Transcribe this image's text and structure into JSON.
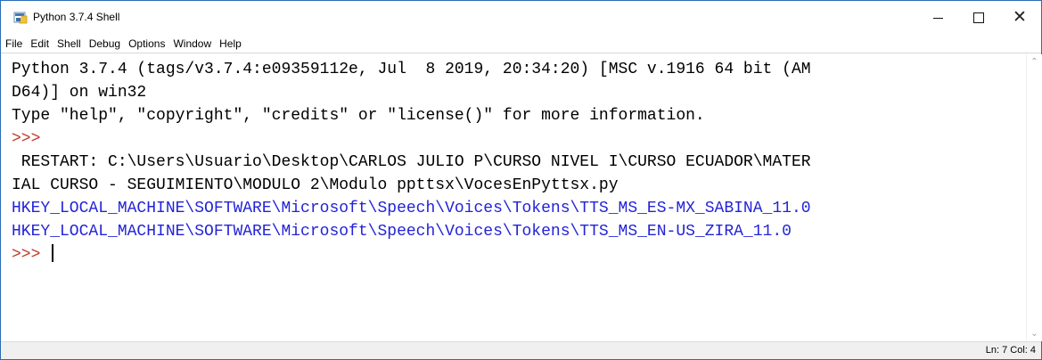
{
  "window": {
    "title": "Python 3.7.4 Shell",
    "icon": "python-idle-icon",
    "controls": {
      "minimize": "minimize",
      "maximize": "maximize",
      "close": "close"
    }
  },
  "menu": [
    "File",
    "Edit",
    "Shell",
    "Debug",
    "Options",
    "Window",
    "Help"
  ],
  "shell": {
    "lines": [
      "Python 3.7.4 (tags/v3.7.4:e09359112e, Jul  8 2019, 20:34:20) [MSC v.1916 64 bit (AM",
      "D64)] on win32",
      "Type \"help\", \"copyright\", \"credits\" or \"license()\" for more information.",
      ">>> ",
      " RESTART: C:\\Users\\Usuario\\Desktop\\CARLOS JULIO P\\CURSO NIVEL I\\CURSO ECUADOR\\MATER",
      "IAL CURSO - SEGUIMIENTO\\MODULO 2\\Modulo ppttsx\\VocesEnPyttsx.py",
      "HKEY_LOCAL_MACHINE\\SOFTWARE\\Microsoft\\Speech\\Voices\\Tokens\\TTS_MS_ES-MX_SABINA_11.0",
      "HKEY_LOCAL_MACHINE\\SOFTWARE\\Microsoft\\Speech\\Voices\\Tokens\\TTS_MS_EN-US_ZIRA_11.0",
      ">>> "
    ],
    "colors": {
      "prompt": "#c0392b",
      "output": "#2323d8",
      "text": "#000000"
    }
  },
  "status": {
    "text": "Ln: 7  Col: 4"
  }
}
